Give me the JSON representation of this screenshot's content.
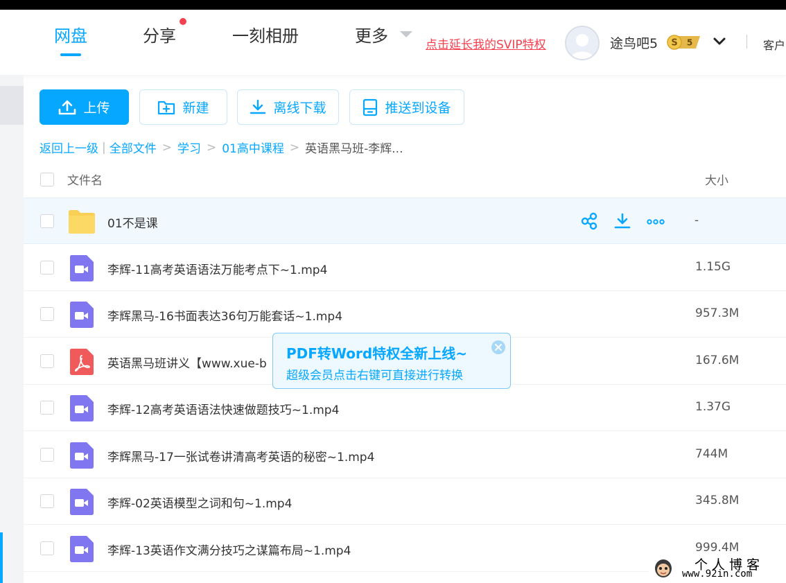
{
  "header": {
    "nav": [
      {
        "label": "网盘",
        "active": true
      },
      {
        "label": "分享",
        "has_dot": true
      },
      {
        "label": "一刻相册"
      },
      {
        "label": "更多"
      }
    ],
    "vip_link": "点击延长我的SVIP特权",
    "username": "途鸟吧5",
    "svip_level": "5",
    "svip_mark": "S",
    "service": "客户"
  },
  "toolbar": {
    "upload": "上传",
    "new_folder": "新建",
    "offline_download": "离线下载",
    "push_device": "推送到设备"
  },
  "breadcrumb": {
    "back": "返回上一级",
    "sep_bar": "|",
    "items": [
      "全部文件",
      "学习",
      "01高中课程"
    ],
    "sep": ">",
    "current": "英语黑马班-李辉..."
  },
  "list": {
    "col_name": "文件名",
    "col_size": "大小",
    "rows": [
      {
        "name": "01不是课",
        "size": "-",
        "type": "folder"
      },
      {
        "name": "李辉-11高考英语语法万能考点下~1.mp4",
        "size": "1.15G",
        "type": "video"
      },
      {
        "name": "李辉黑马-16书面表达36句万能套话~1.mp4",
        "size": "957.3M",
        "type": "video"
      },
      {
        "name": "英语黑马班讲义【www.xue-b",
        "size": "167.6M",
        "type": "pdf"
      },
      {
        "name": "李辉-12高考英语语法快速做题技巧~1.mp4",
        "size": "1.37G",
        "type": "video"
      },
      {
        "name": "李辉黑马-17一张试卷讲清高考英语的秘密~1.mp4",
        "size": "744M",
        "type": "video"
      },
      {
        "name": "李辉-02英语模型之词和句~1.mp4",
        "size": "345.8M",
        "type": "video"
      },
      {
        "name": "李辉-13英语作文满分技巧之谋篇布局~1.mp4",
        "size": "999.4M",
        "type": "video"
      }
    ]
  },
  "tooltip": {
    "title": "PDF转Word特权全新上线~",
    "subtitle": "超级会员点击右键可直接进行转换"
  },
  "watermark": {
    "title": "个人博客",
    "url": "www.92in.com"
  },
  "colors": {
    "accent": "#06a7ff",
    "red": "#f5414f",
    "folder": "#f9cf55",
    "video": "#8077f0",
    "pdf": "#f05a5a"
  }
}
